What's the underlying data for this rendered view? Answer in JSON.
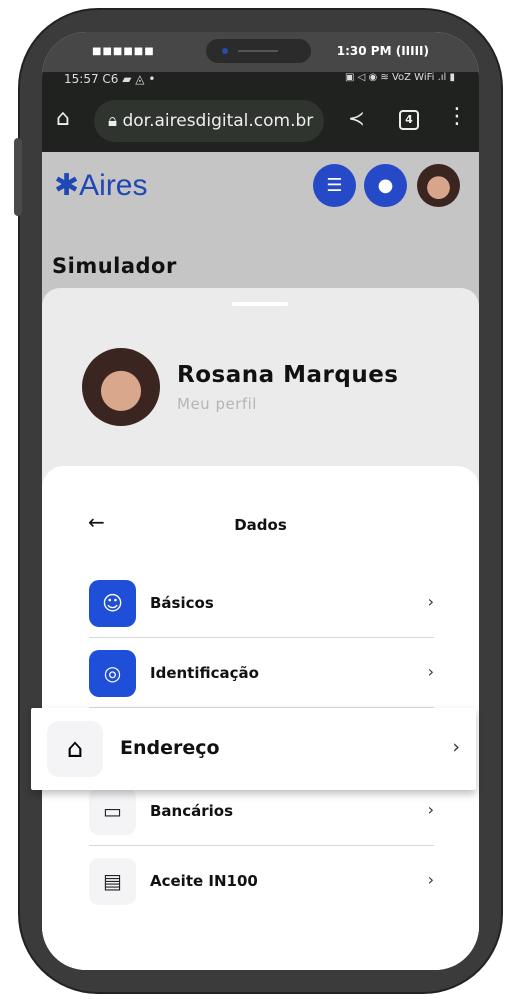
{
  "device": {
    "carrier_dots": "■■■■■■",
    "time": "1:30 PM",
    "battery": "(IIIII)"
  },
  "android_status": {
    "time": "15:57",
    "left_icons": "C6 ▰ ◬ •",
    "right_icons": "▣ ◁ ◉ ≋ VoZ WiFi .ıl ▮"
  },
  "browser": {
    "url": "dor.airesdigital.com.br",
    "tab_count": "4"
  },
  "header": {
    "logo_text": "Aires",
    "page_title": "Simulador"
  },
  "profile": {
    "name": "Rosana Marques",
    "subtitle": "Meu perfil"
  },
  "dados": {
    "title": "Dados",
    "items": [
      {
        "label": "Básicos",
        "icon": "user-icon"
      },
      {
        "label": "Identificação",
        "icon": "fingerprint-icon"
      },
      {
        "label": "Endereço",
        "icon": "house-icon"
      },
      {
        "label": "Bancários",
        "icon": "card-icon"
      },
      {
        "label": "Aceite IN100",
        "icon": "document-check-icon"
      }
    ]
  },
  "colors": {
    "brand": "#1f4fd8",
    "logo": "#1f47b5"
  }
}
